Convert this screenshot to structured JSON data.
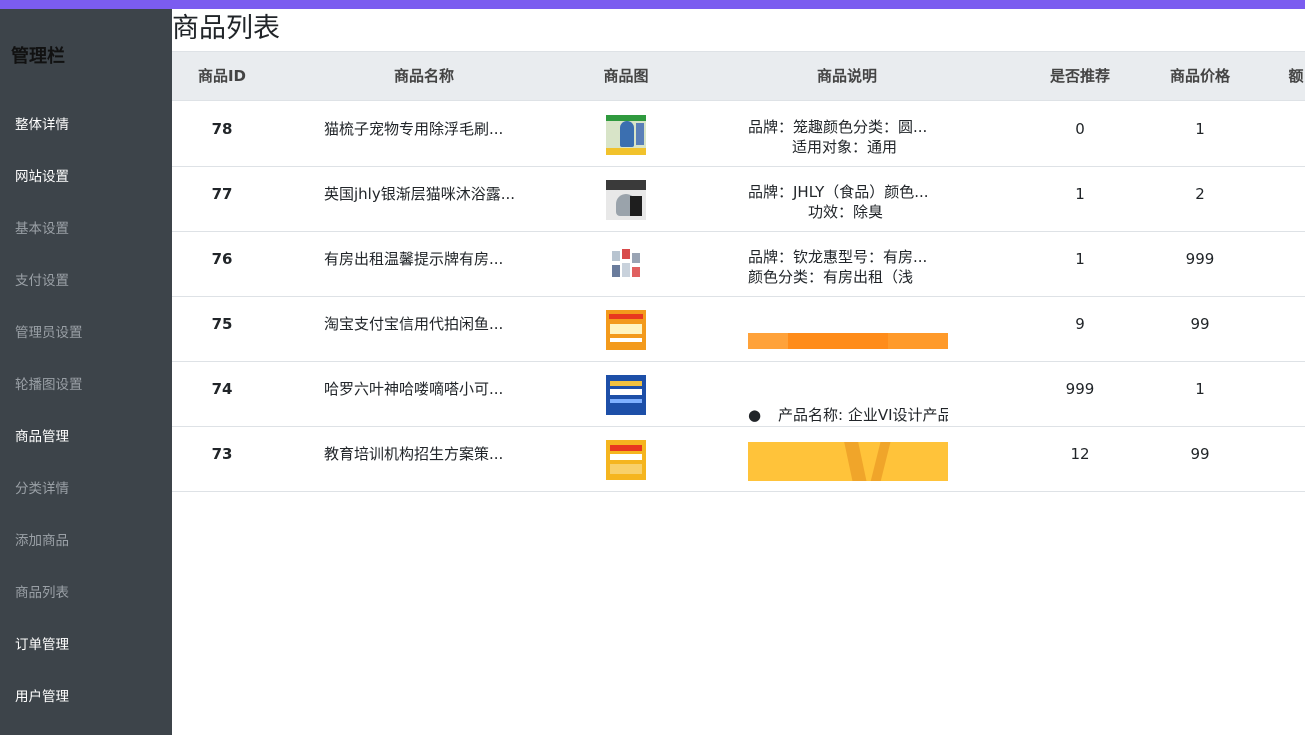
{
  "sidebar": {
    "title": "管理栏",
    "items": [
      {
        "label": "整体详情",
        "sub": false
      },
      {
        "label": "网站设置",
        "sub": false
      },
      {
        "label": "基本设置",
        "sub": true
      },
      {
        "label": "支付设置",
        "sub": true
      },
      {
        "label": "管理员设置",
        "sub": true
      },
      {
        "label": "轮播图设置",
        "sub": true
      },
      {
        "label": "商品管理",
        "sub": false
      },
      {
        "label": "分类详情",
        "sub": true
      },
      {
        "label": "添加商品",
        "sub": true
      },
      {
        "label": "商品列表",
        "sub": true
      },
      {
        "label": "订单管理",
        "sub": false
      },
      {
        "label": "用户管理",
        "sub": false
      }
    ]
  },
  "main": {
    "title": "商品列表",
    "columns": [
      "商品ID",
      "商品名称",
      "商品图",
      "商品说明",
      "是否推荐",
      "商品价格",
      "额"
    ],
    "rows": [
      {
        "id": "78",
        "name": "猫梳子宠物专用除浮毛刷...",
        "desc1": "品牌：笼趣颜色分类：圆...",
        "desc2": "适用对象：通用",
        "recommend": "0",
        "price": "1"
      },
      {
        "id": "77",
        "name": "英国jhly银渐层猫咪沐浴露...",
        "desc1": "品牌：JHLY（食品）颜色...",
        "desc2": "功效：除臭",
        "recommend": "1",
        "price": "2"
      },
      {
        "id": "76",
        "name": "有房出租温馨提示牌有房...",
        "desc1": "品牌：钦龙惠型号：有房...",
        "desc2": "颜色分类：有房出租（浅",
        "recommend": "1",
        "price": "999"
      },
      {
        "id": "75",
        "name": "淘宝支付宝信用代拍闲鱼...",
        "desc1": "",
        "desc2": "",
        "recommend": "9",
        "price": "99"
      },
      {
        "id": "74",
        "name": "哈罗六叶神哈喽嘀嗒小可...",
        "desc1": "",
        "desc2": "产品名称: 企业VI设计产品",
        "recommend": "999",
        "price": "1"
      },
      {
        "id": "73",
        "name": "教育培训机构招生方案策...",
        "desc1": "",
        "desc2": "",
        "recommend": "12",
        "price": "99"
      }
    ]
  },
  "colors": {
    "accent": "#7b5cf0",
    "sidebar_bg": "#3d444a",
    "header_bg": "#e9ecef"
  }
}
